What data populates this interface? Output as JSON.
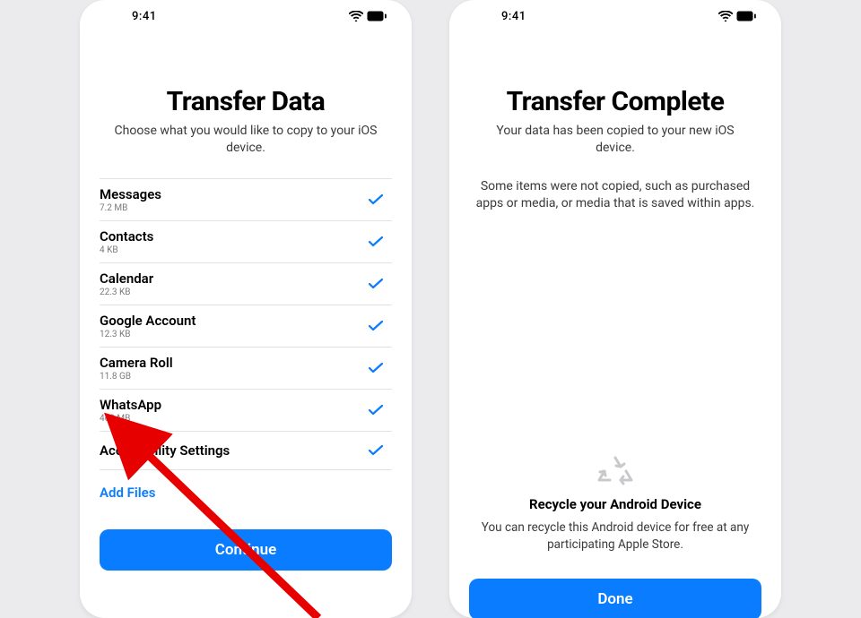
{
  "status": {
    "time": "9:41"
  },
  "left": {
    "title": "Transfer Data",
    "subtitle": "Choose what you would like to copy to your iOS device.",
    "items": [
      {
        "label": "Messages",
        "size": "7.2 MB"
      },
      {
        "label": "Contacts",
        "size": "4 KB"
      },
      {
        "label": "Calendar",
        "size": "22.3 KB"
      },
      {
        "label": "Google Account",
        "size": "12.3 KB"
      },
      {
        "label": "Camera Roll",
        "size": "11.8 GB"
      },
      {
        "label": "WhatsApp",
        "size": "463 MB"
      },
      {
        "label": "Accessibility Settings",
        "size": ""
      }
    ],
    "add_files": "Add Files",
    "continue": "Continue"
  },
  "right": {
    "title": "Transfer Complete",
    "subtitle": "Your data has been copied to your new iOS device.",
    "note": "Some items were not copied, such as purchased apps or media, or media that is saved within apps.",
    "recycle_title": "Recycle your Android Device",
    "recycle_desc": "You can recycle this Android device for free at any participating Apple Store.",
    "done": "Done"
  }
}
